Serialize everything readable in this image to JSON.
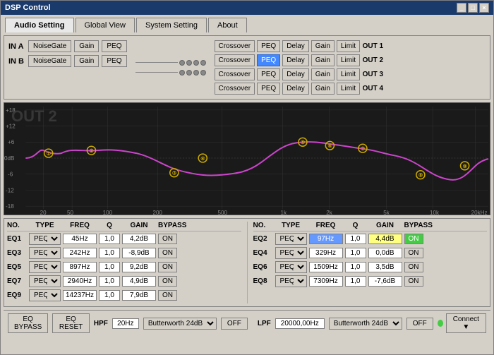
{
  "window": {
    "title": "DSP Control",
    "buttons": [
      "_",
      "□",
      "×"
    ]
  },
  "tabs": [
    {
      "label": "Audio Setting",
      "active": true
    },
    {
      "label": "Global View",
      "active": false
    },
    {
      "label": "System Setting",
      "active": false
    },
    {
      "label": "About",
      "active": false
    }
  ],
  "inputs": [
    {
      "label": "IN A",
      "buttons": [
        "NoiseGate",
        "Gain",
        "PEQ"
      ]
    },
    {
      "label": "IN B",
      "buttons": [
        "NoiseGate",
        "Gain",
        "PEQ"
      ]
    }
  ],
  "outputs": [
    {
      "label": "OUT 1",
      "buttons": [
        "Crossover",
        "PEQ",
        "Delay",
        "Gain",
        "Limit"
      ],
      "active_btn": null
    },
    {
      "label": "OUT 2",
      "buttons": [
        "Crossover",
        "PEQ",
        "Delay",
        "Gain",
        "Limit"
      ],
      "active_btn": 1
    },
    {
      "label": "OUT 3",
      "buttons": [
        "Crossover",
        "PEQ",
        "Delay",
        "Gain",
        "Limit"
      ],
      "active_btn": null
    },
    {
      "label": "OUT 4",
      "buttons": [
        "Crossover",
        "PEQ",
        "Delay",
        "Gain",
        "Limit"
      ],
      "active_btn": null
    }
  ],
  "chart": {
    "label": "OUT 2",
    "db_labels": [
      "+18",
      "+12",
      "+6",
      "0dB",
      "-6",
      "-12",
      "-18"
    ],
    "freq_labels": [
      "20",
      "50",
      "100",
      "200",
      "500",
      "1k",
      "2k",
      "5k",
      "10k",
      "20kHz"
    ],
    "curve_color": "#cc44cc"
  },
  "eq_headers": {
    "no": "NO.",
    "type": "TYPE",
    "freq": "FREQ",
    "q": "Q",
    "gain": "GAIN",
    "bypass": "BYPASS"
  },
  "eq_left": [
    {
      "num": "EQ1",
      "type": "PEQ",
      "freq": "45Hz",
      "q": "1,0",
      "gain": "4,2dB",
      "bypass": "ON",
      "active": false
    },
    {
      "num": "EQ3",
      "type": "PEQ",
      "freq": "242Hz",
      "q": "1,0",
      "gain": "-8,9dB",
      "bypass": "ON",
      "active": false
    },
    {
      "num": "EQ5",
      "type": "PEQ",
      "freq": "897Hz",
      "q": "1,0",
      "gain": "9,2dB",
      "bypass": "ON",
      "active": false
    },
    {
      "num": "EQ7",
      "type": "PEQ",
      "freq": "2940Hz",
      "q": "1,0",
      "gain": "4,9dB",
      "bypass": "ON",
      "active": false
    },
    {
      "num": "EQ9",
      "type": "PEQ",
      "freq": "14237Hz",
      "q": "1,0",
      "gain": "7,9dB",
      "bypass": "ON",
      "active": false
    }
  ],
  "eq_right": [
    {
      "num": "EQ2",
      "type": "PEQ",
      "freq": "97Hz",
      "q": "1,0",
      "gain": "4,4dB",
      "bypass": "ON",
      "active": true,
      "freq_highlight": true,
      "gain_highlight": true
    },
    {
      "num": "EQ4",
      "type": "PEQ",
      "freq": "329Hz",
      "q": "1,0",
      "gain": "0,0dB",
      "bypass": "ON",
      "active": false
    },
    {
      "num": "EQ6",
      "type": "PEQ",
      "freq": "1509Hz",
      "q": "1,0",
      "gain": "3,5dB",
      "bypass": "ON",
      "active": false
    },
    {
      "num": "EQ8",
      "type": "PEQ",
      "freq": "7309Hz",
      "q": "1,0",
      "gain": "-7,6dB",
      "bypass": "ON",
      "active": false
    }
  ],
  "bottom": {
    "eq_bypass": "EQ BYPASS",
    "eq_reset": "EQ RESET",
    "hpf_label": "HPF",
    "hpf_freq": "20Hz",
    "hpf_filter": "Butterworth 24dB",
    "hpf_off": "OFF",
    "lpf_label": "LPF",
    "lpf_freq": "20000,00Hz",
    "lpf_filter": "Butterworth 24dB",
    "lpf_off": "OFF",
    "connect": "Connect"
  }
}
